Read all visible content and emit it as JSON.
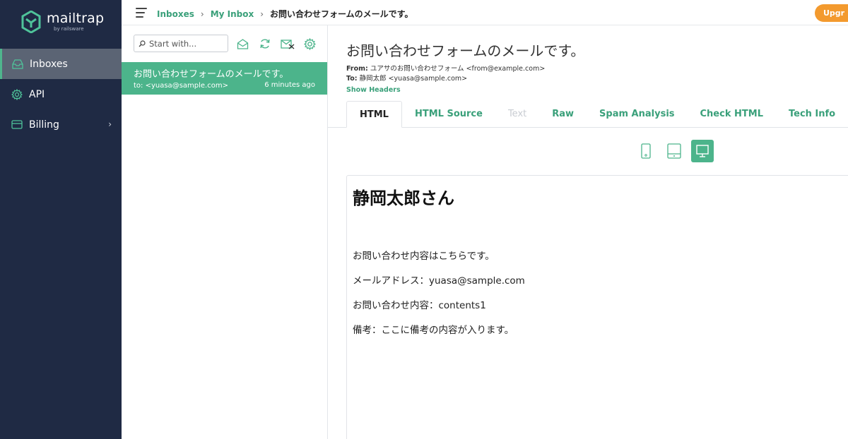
{
  "brand": {
    "name": "mailtrap",
    "sub": "by railsware"
  },
  "sidebar": {
    "items": [
      {
        "label": "Inboxes",
        "icon": "inbox-icon"
      },
      {
        "label": "API",
        "icon": "gear-icon"
      },
      {
        "label": "Billing",
        "icon": "card-icon"
      }
    ]
  },
  "topbar": {
    "breadcrumb": [
      "Inboxes",
      "My Inbox",
      "お問い合わせフォームのメールです。"
    ],
    "upgrade_label": "Upgr"
  },
  "list": {
    "search_placeholder": "Start with...",
    "messages": [
      {
        "subject": "お問い合わせフォームのメールです。",
        "to": "to: <yuasa@sample.com>",
        "time": "6 minutes ago"
      }
    ]
  },
  "message": {
    "subject": "お問い合わせフォームのメールです。",
    "from_label": "From:",
    "from_value": "ユアサのお問い合わせフォーム <from@example.com>",
    "to_label": "To:",
    "to_value": "静岡太郎 <yuasa@sample.com>",
    "show_headers": "Show Headers",
    "tabs": [
      {
        "label": "HTML",
        "state": "active"
      },
      {
        "label": "HTML Source",
        "state": "normal"
      },
      {
        "label": "Text",
        "state": "disabled"
      },
      {
        "label": "Raw",
        "state": "normal"
      },
      {
        "label": "Spam Analysis",
        "state": "normal"
      },
      {
        "label": "Check HTML",
        "state": "normal"
      },
      {
        "label": "Tech Info",
        "state": "normal"
      }
    ],
    "body": {
      "heading": "静岡太郎さん",
      "lines": [
        "お問い合わせ内容はこちらです。",
        "メールアドレス：yuasa@sample.com",
        "お問い合わせ内容：contents1",
        "備考：ここに備考の内容が入ります。"
      ]
    }
  },
  "colors": {
    "sidebar_bg": "#1f2a44",
    "accent": "#4cb48b",
    "link": "#3aa07a",
    "upgrade": "#f39a2e"
  }
}
